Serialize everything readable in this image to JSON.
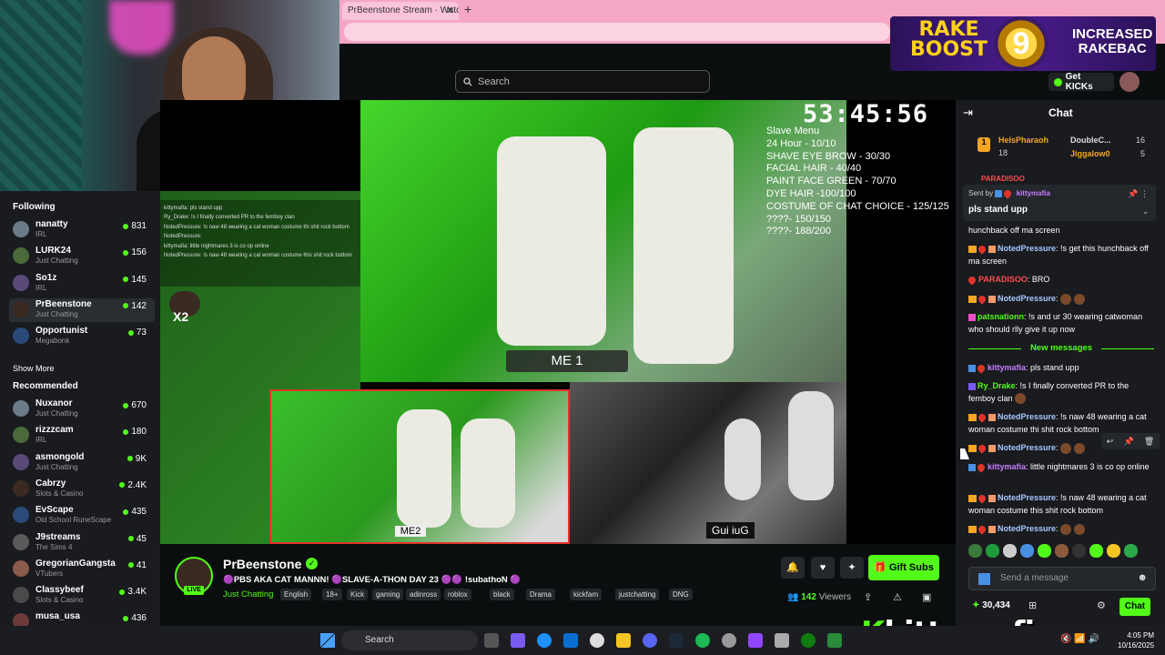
{
  "browser": {
    "tab_title": "PrBeenstone Stream · Watch",
    "close_glyph": "✕",
    "new_tab_glyph": "+"
  },
  "topbar": {
    "search_placeholder": "Search",
    "get_kicks": "Get KICKs"
  },
  "banner": {
    "line1": "RAKE",
    "line2": "BOOST",
    "number": "9",
    "right1": "INCREASED",
    "right2": "RAKEBAC"
  },
  "sidebar": {
    "following_label": "Following",
    "following": [
      {
        "name": "nanatty",
        "category": "IRL",
        "viewers": "831"
      },
      {
        "name": "LURK24",
        "category": "Just Chatting",
        "viewers": "156"
      },
      {
        "name": "So1z",
        "category": "IRL",
        "viewers": "145"
      },
      {
        "name": "PrBeenstone",
        "category": "Just Chatting",
        "viewers": "142"
      },
      {
        "name": "Opportunist",
        "category": "Megabonk",
        "viewers": "73"
      }
    ],
    "show_more": "Show More",
    "recommended_label": "Recommended",
    "recommended": [
      {
        "name": "Nuxanor",
        "category": "Just Chatting",
        "viewers": "670"
      },
      {
        "name": "rizzzcam",
        "category": "IRL",
        "viewers": "180"
      },
      {
        "name": "asmongold",
        "category": "Just Chatting",
        "viewers": "9K"
      },
      {
        "name": "Cabrzy",
        "category": "Slots & Casino",
        "viewers": "2.4K"
      },
      {
        "name": "EvScape",
        "category": "Old School RuneScape",
        "viewers": "435"
      },
      {
        "name": "J9streams",
        "category": "The Sims 4",
        "viewers": "45"
      },
      {
        "name": "GregorianGangsta",
        "category": "VTubers",
        "viewers": "41"
      },
      {
        "name": "Classybeef",
        "category": "Slots & Casino",
        "viewers": "3.4K"
      },
      {
        "name": "musa_usa",
        "category": "",
        "viewers": "436"
      }
    ]
  },
  "video": {
    "timer": "53:45:56",
    "menu_text": "Slave Menu\n24 Hour - 10/10\nSHAVE EYE BROW - 30/30\nFACIAL HAIR - 40/40\nPAINT FACE GREEN - 70/70\nDYE HAIR -100/100\nCOSTUME OF CHAT CHOICE - 125/125\n????- 150/150\n????- 188/200",
    "me1": "ME 1",
    "me2": "ME2",
    "gui": "Gui iuG",
    "x2": "X2",
    "overlay_chat": [
      "kittymafia: pls stand upp",
      "Ry_Drake: !s I finally converted PR to the femboy clan",
      "NotedPressure: !s naw 48 wearing a cat woman costume thi shit rock bottom",
      "NotedPressure:",
      "kittymafia: little nightmares 3 is co op online",
      "NotedPressure: !s naw 48 wearing a cat woman costume this shit rock bottom"
    ]
  },
  "stream": {
    "name": "PrBeenstone",
    "live": "LIVE",
    "title": "🟣PBS AKA CAT MANNN! 🟣SLAVE-A-THON DAY 23 🟣🟣 !subathoN 🟣",
    "category": "Just Chatting",
    "tags": [
      "English",
      "18+",
      "Kick",
      "gaming",
      "adinross",
      "roblox",
      "black",
      "Drama",
      "kickfam",
      "justchatting",
      "DNG"
    ],
    "viewers": "142",
    "viewers_label": "Viewers",
    "gift_subs": "Gift Subs"
  },
  "chat": {
    "title": "Chat",
    "gifters": [
      {
        "rank": "1",
        "name": "HelsPharaoh",
        "count": "18"
      },
      {
        "rank": "",
        "name": "DoubleC...",
        "count": "16"
      },
      {
        "rank": "",
        "name": "Jiggalow0",
        "count": "5"
      }
    ],
    "pinned_sent_by": "Sent by",
    "pinned_user": "kittymafia",
    "pinned_message": "pls stand upp",
    "partial_top": "PARADISOO",
    "messages": [
      {
        "user": "",
        "color": "#fff",
        "text": "hunchback off ma screen"
      },
      {
        "user": "NotedPressure",
        "color": "#a8c8ff",
        "text": ": !s get this hunchback off ma screen"
      },
      {
        "user": "PARADISOO",
        "color": "#ff4d4d",
        "text": ": BRO"
      },
      {
        "user": "NotedPressure",
        "color": "#a8c8ff",
        "text": ":"
      },
      {
        "user": "patsnationn",
        "color": "#53fc18",
        "text": ": !s and ur 30 wearing catwoman who should rlly give it up now"
      },
      {
        "user": "kittymafia",
        "color": "#c77dff",
        "text": ": pls stand upp"
      },
      {
        "user": "Ry_Drake",
        "color": "#53fc18",
        "text": ": !s I finally converted PR to the femboy clan"
      },
      {
        "user": "NotedPressure",
        "color": "#a8c8ff",
        "text": ": !s naw 48 wearing a cat woman costume thi shit rock bottom"
      },
      {
        "user": "NotedPressure",
        "color": "#a8c8ff",
        "text": ":"
      },
      {
        "user": "kittymafia",
        "color": "#c77dff",
        "text": ": little nightmares 3 is co op online"
      },
      {
        "user": "NotedPressure",
        "color": "#a8c8ff",
        "text": ": !s naw 48 wearing a cat woman costume this shit rock bottom"
      },
      {
        "user": "NotedPressure",
        "color": "#a8c8ff",
        "text": ":"
      }
    ],
    "new_messages": "New messages",
    "input_placeholder": "Send a message",
    "points": "30,434",
    "chat_button": "Chat"
  },
  "overlay": {
    "logo_k": "K",
    "logo_text": "kittymafia"
  },
  "taskbar": {
    "search": "Search",
    "time": "4:05 PM",
    "date": "10/16/2025"
  }
}
